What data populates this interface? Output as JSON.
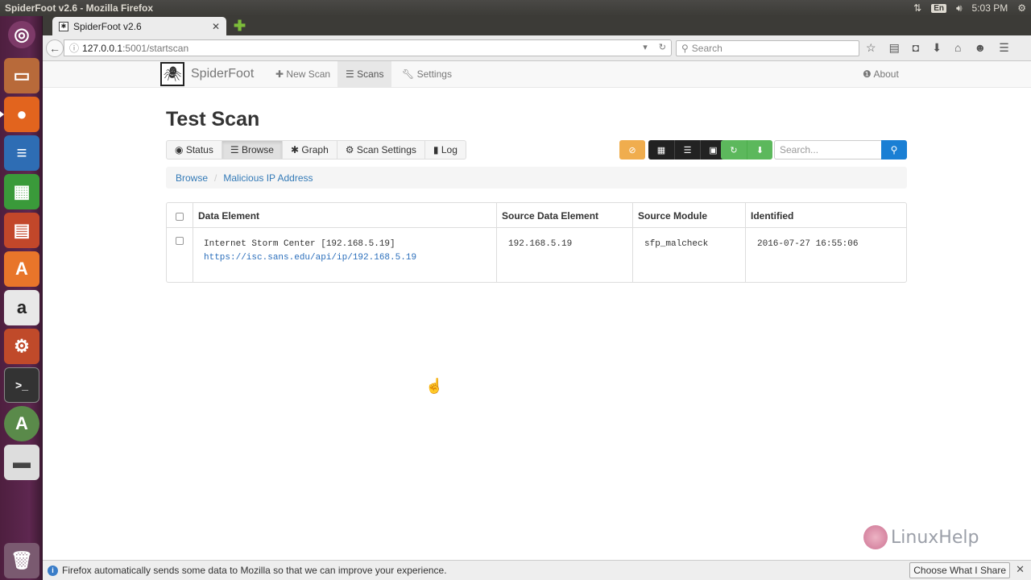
{
  "os": {
    "window_title": "SpiderFoot v2.6 - Mozilla Firefox",
    "keyboard_layout": "En",
    "clock": "5:03 PM",
    "launcher": [
      "ubuntu-icon",
      "files-icon",
      "firefox-icon",
      "writer-icon",
      "calc-icon",
      "impress-icon",
      "software-center-icon",
      "amazon-icon",
      "system-settings-icon",
      "terminal-icon",
      "software-updater-icon",
      "drive-icon",
      "trash-icon"
    ]
  },
  "browser": {
    "tab_title": "SpiderFoot v2.6",
    "url_host": "127.0.0.1",
    "url_path": ":5001/startscan",
    "search_placeholder": "Search",
    "notification": "Firefox automatically sends some data to Mozilla so that we can improve your experience.",
    "notification_button": "Choose What I Share"
  },
  "app": {
    "brand": "SpiderFoot",
    "nav": {
      "new_scan": "New Scan",
      "scans": "Scans",
      "settings": "Settings",
      "about": "About"
    },
    "scan_title": "Test Scan",
    "tabs": {
      "status": "Status",
      "browse": "Browse",
      "graph": "Graph",
      "scan_settings": "Scan Settings",
      "log": "Log"
    },
    "search_placeholder": "Search...",
    "breadcrumb": [
      "Browse",
      "Malicious IP Address"
    ],
    "table": {
      "headers": [
        "Data Element",
        "Source Data Element",
        "Source Module",
        "Identified"
      ],
      "rows": [
        {
          "data_element": "Internet Storm Center [192.168.5.19]",
          "data_link": "https://isc.sans.edu/api/ip/192.168.5.19",
          "source": "192.168.5.19",
          "module": "sfp_malcheck",
          "identified": "2016-07-27 16:55:06"
        }
      ]
    }
  },
  "watermark": "LinuxHelp",
  "colors": {
    "orange": "#f0ad4e",
    "green": "#5cb85c",
    "primary": "#1a7fd4",
    "link": "#337ab7"
  }
}
